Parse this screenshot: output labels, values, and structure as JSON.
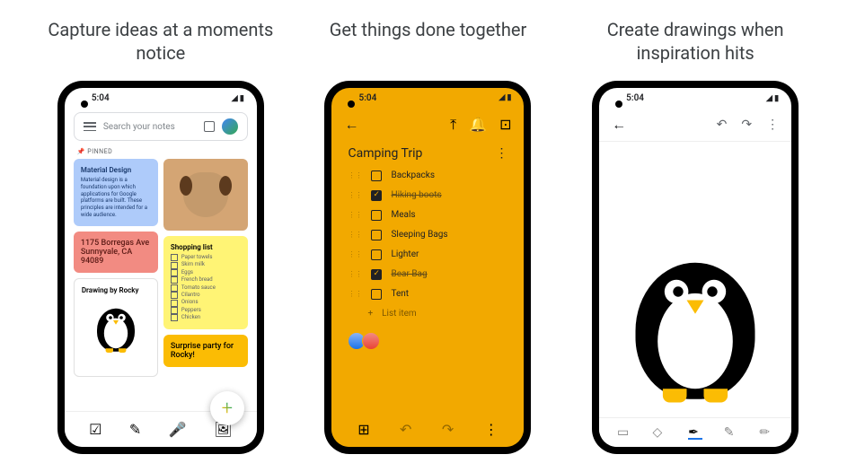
{
  "headlines": [
    "Capture ideas at a moments notice",
    "Get things done together",
    "Create drawings when inspiration hits"
  ],
  "status_time": "5:04",
  "search": {
    "placeholder": "Search your notes"
  },
  "pinned_label": "📌 PINNED",
  "notes": {
    "material": {
      "title": "Material Design",
      "body": "Material design is a foundation upon which applications for Google platforms are built. These principles are intended for a wide audience."
    },
    "address": {
      "body": "1175 Borregas Ave Sunnyvale, CA 94089"
    },
    "drawing": {
      "title": "Drawing by Rocky"
    },
    "shopping": {
      "title": "Shopping list",
      "items": [
        "Paper towels",
        "Skim milk",
        "Eggs",
        "French bread",
        "Tomato sauce",
        "Cilantro",
        "Onions",
        "Peppers",
        "Chicken"
      ]
    },
    "surprise": {
      "title": "Surprise party for Rocky!"
    }
  },
  "camping": {
    "title": "Camping Trip",
    "items": [
      {
        "label": "Backpacks",
        "checked": false
      },
      {
        "label": "Hiking boots",
        "checked": true
      },
      {
        "label": "Meals",
        "checked": false
      },
      {
        "label": "Sleeping Bags",
        "checked": false
      },
      {
        "label": "Lighter",
        "checked": false
      },
      {
        "label": "Bear Bag",
        "checked": true
      },
      {
        "label": "Tent",
        "checked": false
      }
    ],
    "add_label": "List item"
  }
}
